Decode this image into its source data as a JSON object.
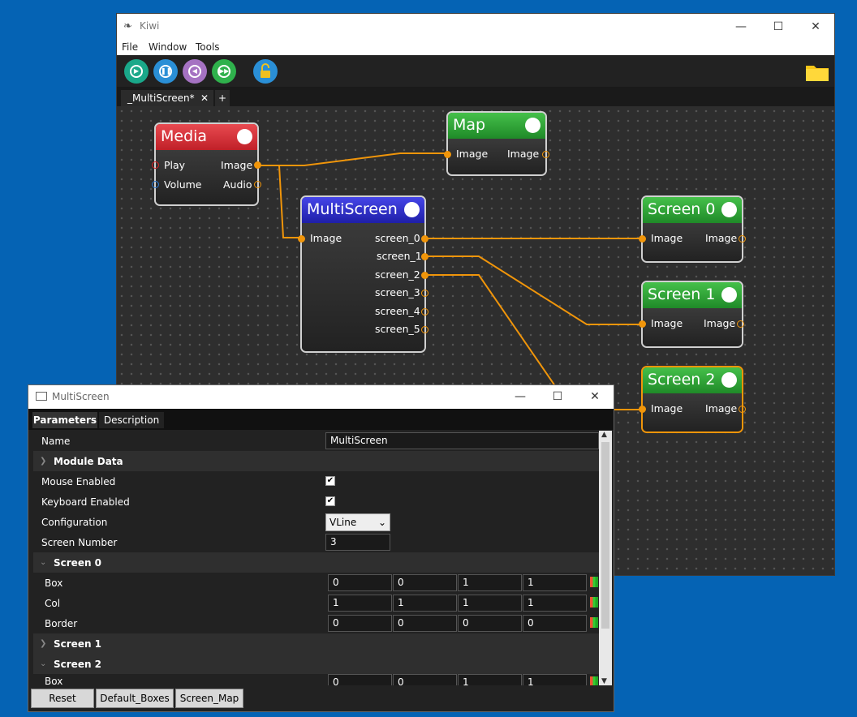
{
  "main_window": {
    "title": "Kiwi",
    "menu": [
      "File",
      "Window",
      "Tools"
    ],
    "toolbar": {
      "play_color": "#1aa88a",
      "pause_color": "#2a8fd6",
      "prev_color": "#a572c2",
      "next_color": "#2fb14c",
      "lock_color": "#2a8fd6"
    },
    "tab_label": "_MultiScreen*",
    "tab_add": "+"
  },
  "nodes": {
    "media": {
      "title": "Media",
      "color": "#d9323a",
      "in": [
        "Play",
        "Volume"
      ],
      "out": [
        "Image",
        "Audio"
      ]
    },
    "map": {
      "title": "Map",
      "color": "#2fa83a",
      "in": [
        "Image"
      ],
      "out": [
        "Image"
      ]
    },
    "multiscreen": {
      "title": "MultiScreen",
      "color": "#2a2ad0",
      "in": [
        "Image"
      ],
      "out": [
        "screen_0",
        "screen_1",
        "screen_2",
        "screen_3",
        "screen_4",
        "screen_5"
      ]
    },
    "screen0": {
      "title": "Screen 0",
      "color": "#2fa83a",
      "in": [
        "Image"
      ],
      "out": [
        "Image"
      ]
    },
    "screen1": {
      "title": "Screen 1",
      "color": "#2fa83a",
      "in": [
        "Image"
      ],
      "out": [
        "Image"
      ]
    },
    "screen2": {
      "title": "Screen 2",
      "color": "#2fa83a",
      "in": [
        "Image"
      ],
      "out": [
        "Image"
      ]
    }
  },
  "link_color": "#f0950a",
  "properties": {
    "title": "MultiScreen",
    "tabs": [
      "Parameters",
      "Description"
    ],
    "name_label": "Name",
    "name_value": "MultiScreen",
    "module_data": "Module Data",
    "mouse_enabled": "Mouse Enabled",
    "keyboard_enabled": "Keyboard Enabled",
    "configuration": "Configuration",
    "configuration_value": "VLine",
    "screen_number": "Screen Number",
    "screen_number_value": "3",
    "screen0": {
      "label": "Screen 0",
      "box_label": "Box",
      "box": [
        "0",
        "0",
        "1",
        "1"
      ],
      "col_label": "Col",
      "col": [
        "1",
        "1",
        "1",
        "1"
      ],
      "border_label": "Border",
      "border": [
        "0",
        "0",
        "0",
        "0"
      ]
    },
    "screen1": "Screen 1",
    "screen2": "Screen 2",
    "screen2_box_label": "Box",
    "screen2_box": [
      "0",
      "0",
      "1",
      "1"
    ],
    "buttons": [
      "Reset",
      "Default_Boxes",
      "Screen_Map"
    ]
  }
}
